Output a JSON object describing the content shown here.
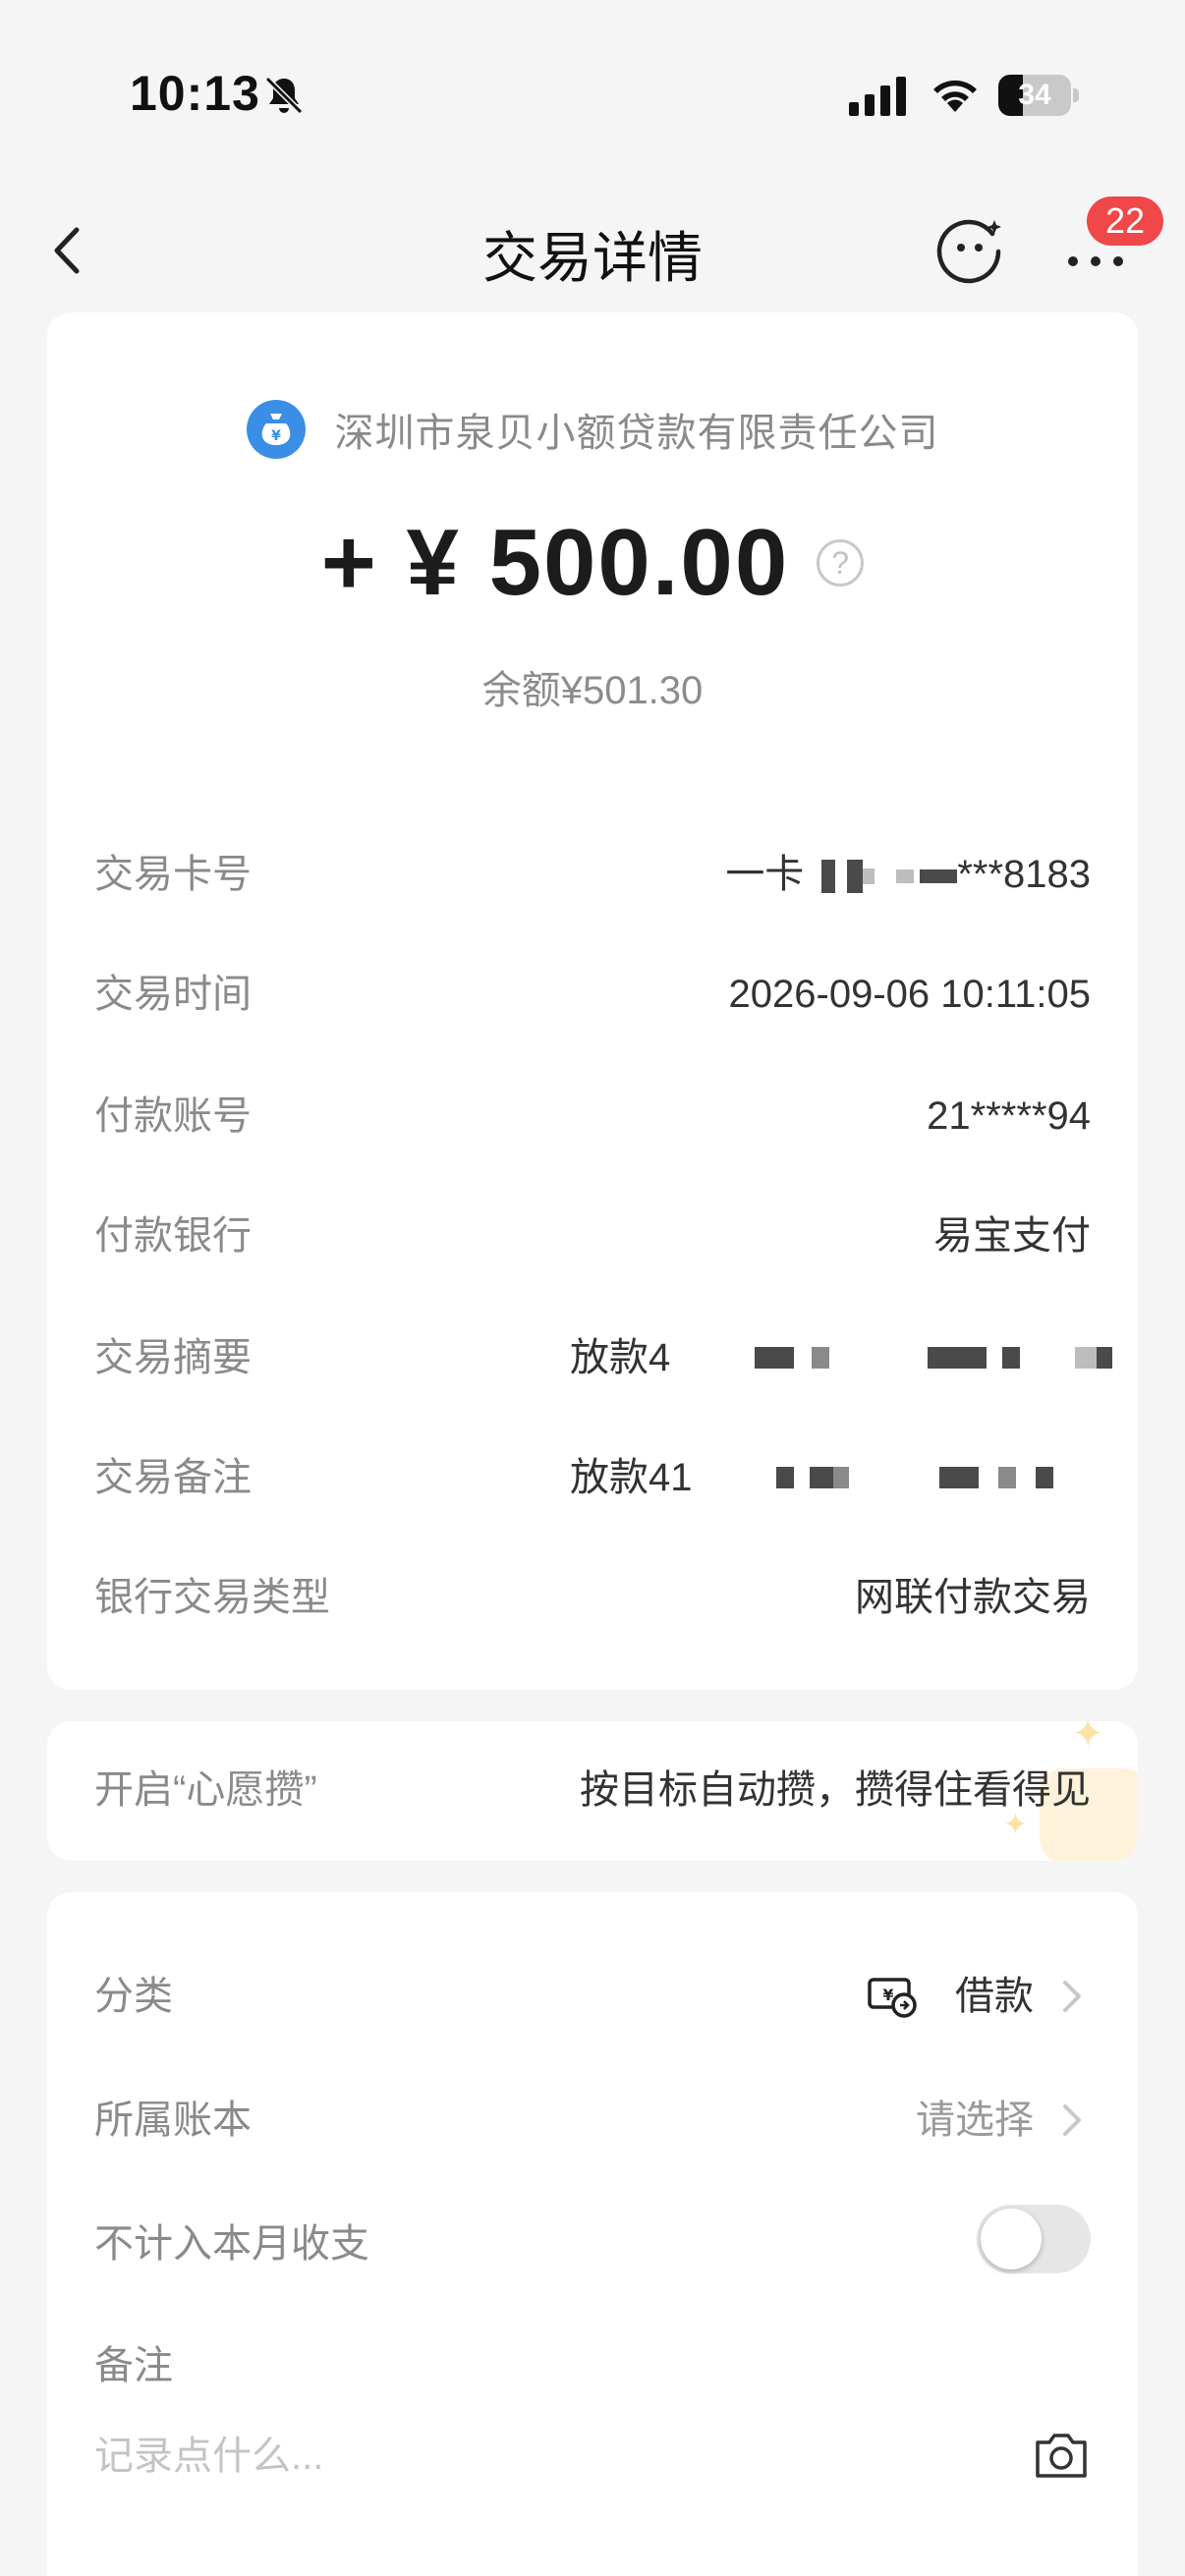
{
  "status_bar": {
    "time": "10:13",
    "battery_level": "34",
    "battery_fraction": 0.34,
    "icons": [
      "bell-muted-icon",
      "cellular-signal-icon",
      "wifi-icon",
      "battery-icon"
    ]
  },
  "nav": {
    "title": "交易详情",
    "badge_count": "22",
    "icons": [
      "back-arrow-icon",
      "smiley-assistant-icon",
      "more-options-icon"
    ]
  },
  "summary": {
    "merchant": "深圳市泉贝小额贷款有限责任公司",
    "amount": "+ ¥ 500.00",
    "help_glyph": "?",
    "balance": "余额¥501.30",
    "merchant_icon": "money-bag-icon",
    "merchant_icon_color": "#3a8ee6"
  },
  "details": [
    {
      "label": "交易卡号",
      "prefix": "一卡",
      "suffix": "***8183"
    },
    {
      "label": "交易时间",
      "value": "2026-09-06 10:11:05"
    },
    {
      "label": "付款账号",
      "value": "21*****94"
    },
    {
      "label": "付款银行",
      "value": "易宝支付"
    },
    {
      "label": "交易摘要",
      "value": "放款4"
    },
    {
      "label": "交易备注",
      "value": "放款41"
    },
    {
      "label": "银行交易类型",
      "value": "网联付款交易"
    }
  ],
  "wish": {
    "label": "开启“心愿攒”",
    "value": "按目标自动攒，攒得住看得见"
  },
  "classification": {
    "category_label": "分类",
    "category_value": "借款",
    "ledger_label": "所属账本",
    "ledger_value": "请选择",
    "exclude_label": "不计入本月收支",
    "exclude_toggle_on": false,
    "memo_label": "备注",
    "memo_placeholder": "记录点什么..."
  },
  "colors": {
    "background": "#f5f5f5",
    "card": "#ffffff",
    "badge": "#f04848",
    "label_gray": "#8a8a8a"
  }
}
